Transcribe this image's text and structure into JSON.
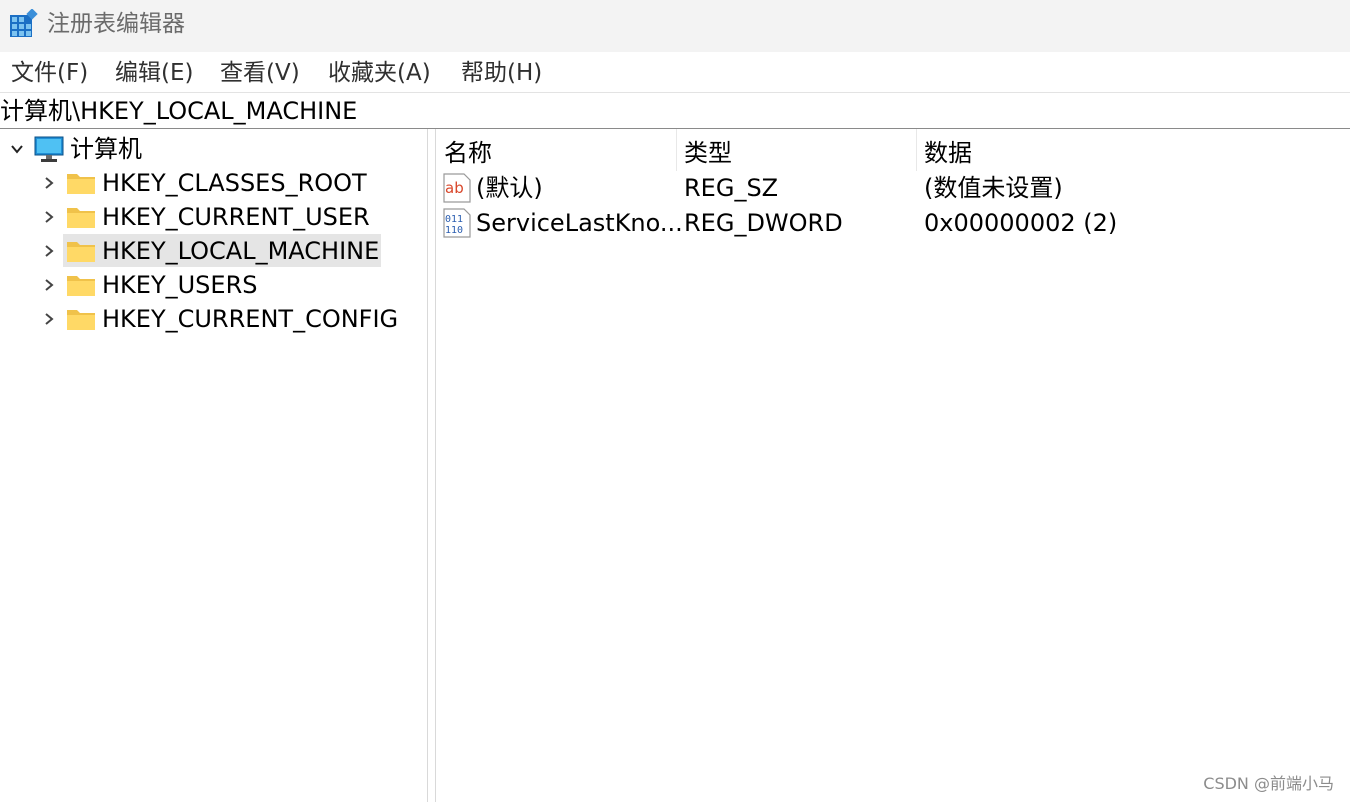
{
  "window": {
    "title": "注册表编辑器"
  },
  "menu": [
    "文件(F)",
    "编辑(E)",
    "查看(V)",
    "收藏夹(A)",
    "帮助(H)"
  ],
  "address": "计算机\\HKEY_LOCAL_MACHINE",
  "tree": {
    "root": "计算机",
    "items": [
      "HKEY_CLASSES_ROOT",
      "HKEY_CURRENT_USER",
      "HKEY_LOCAL_MACHINE",
      "HKEY_USERS",
      "HKEY_CURRENT_CONFIG"
    ],
    "selected": "HKEY_LOCAL_MACHINE"
  },
  "list": {
    "headers": [
      "名称",
      "类型",
      "数据"
    ],
    "rows": [
      {
        "name": "(默认)",
        "type": "REG_SZ",
        "data": "(数值未设置)",
        "icon": "string-value-icon"
      },
      {
        "name": "ServiceLastKno...",
        "type": "REG_DWORD",
        "data": "0x00000002 (2)",
        "icon": "binary-value-icon"
      }
    ]
  },
  "watermark": "CSDN @前端小马"
}
